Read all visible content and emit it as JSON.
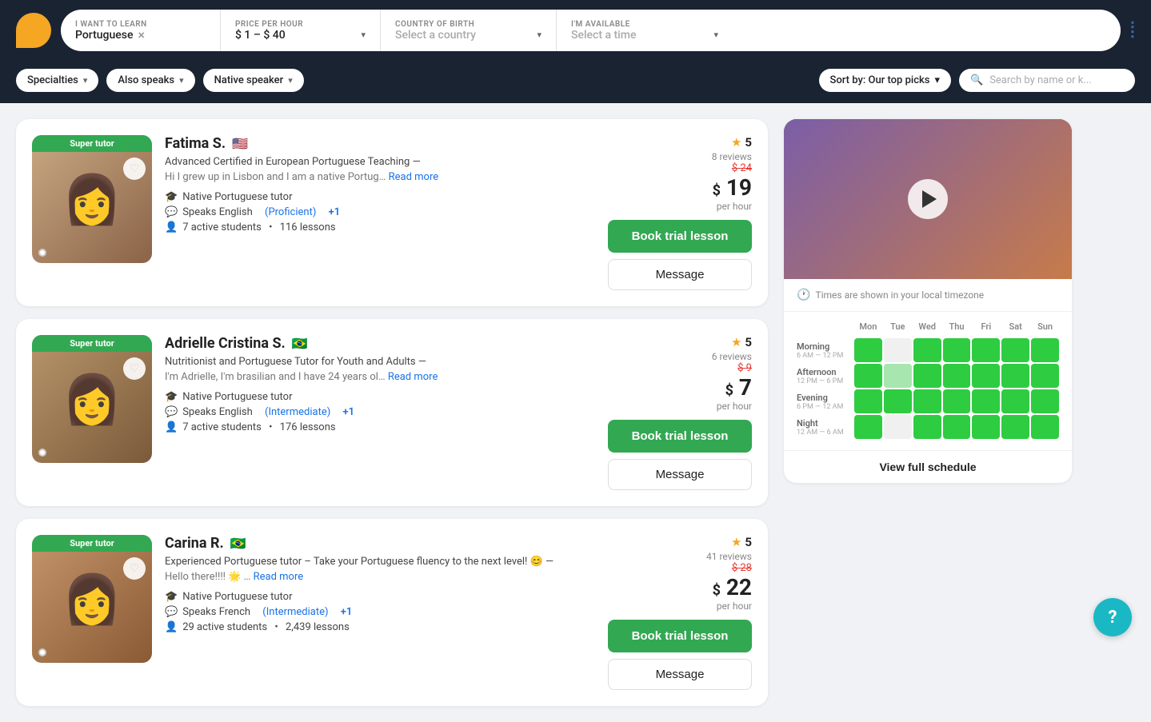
{
  "logo": {
    "alt": "Preply logo"
  },
  "topbar": {
    "learn_label": "I WANT TO LEARN",
    "learn_value": "Portuguese",
    "price_label": "PRICE PER HOUR",
    "price_value": "$ 1 – $ 40",
    "country_label": "COUNTRY OF BIRTH",
    "country_placeholder": "Select a country",
    "available_label": "I'M AVAILABLE",
    "available_placeholder": "Select a time"
  },
  "subbar": {
    "specialties_label": "Specialties",
    "also_speaks_label": "Also speaks",
    "native_speaker_label": "Native speaker",
    "sort_label": "Sort by: Our top picks",
    "search_placeholder": "Search by name or k..."
  },
  "tutors": [
    {
      "name": "Fatima S.",
      "flag": "🇺🇸",
      "badge": "Super tutor",
      "headline": "Advanced Certified in European Portuguese Teaching —",
      "bio": "Hi I grew up in Lisbon and I am a native Portug…",
      "native_tag": "Native Portuguese tutor",
      "speaks": "Speaks English",
      "speaks_level": "(Proficient)",
      "speaks_plus": "+1",
      "students": "7 active students",
      "lessons": "116 lessons",
      "rating": "5",
      "reviews": "8 reviews",
      "price_old": "$ 24",
      "price_new": "19",
      "price_per": "per hour",
      "btn_trial": "Book trial lesson",
      "btn_message": "Message",
      "photo_class": "fatima-bg"
    },
    {
      "name": "Adrielle Cristina S.",
      "flag": "🇧🇷",
      "badge": "Super tutor",
      "headline": "Nutritionist and Portuguese Tutor for Youth and Adults —",
      "bio": "I'm Adrielle, I'm brasilian and I have 24 years ol…",
      "native_tag": "Native Portuguese tutor",
      "speaks": "Speaks English",
      "speaks_level": "(Intermediate)",
      "speaks_plus": "+1",
      "students": "7 active students",
      "lessons": "176 lessons",
      "rating": "5",
      "reviews": "6 reviews",
      "price_old": "$ 9",
      "price_new": "7",
      "price_per": "per hour",
      "btn_trial": "Book trial lesson",
      "btn_message": "Message",
      "photo_class": "adrielle-bg"
    },
    {
      "name": "Carina R.",
      "flag": "🇧🇷",
      "badge": "Super tutor",
      "headline": "Experienced Portuguese tutor – Take your Portuguese fluency to the next level! 😊 —",
      "bio": "Hello there!!!! 🌟 …",
      "native_tag": "Native Portuguese tutor",
      "speaks": "Speaks French",
      "speaks_level": "(Intermediate)",
      "speaks_plus": "+1",
      "students": "29 active students",
      "lessons": "2,439 lessons",
      "rating": "5",
      "reviews": "41 reviews",
      "price_old": "$ 28",
      "price_new": "22",
      "price_per": "per hour",
      "btn_trial": "Book trial lesson",
      "btn_message": "Message",
      "photo_class": "carina-bg"
    }
  ],
  "sidebar": {
    "timezone_note": "Times are shown in your local timezone",
    "days": [
      "Mon",
      "Tue",
      "Wed",
      "Thu",
      "Fri",
      "Sat",
      "Sun"
    ],
    "schedule_rows": [
      {
        "name": "Morning",
        "range": "6 AM — 12 PM",
        "cells": [
          "green",
          "empty",
          "green",
          "green",
          "green",
          "green",
          "green"
        ]
      },
      {
        "name": "Afternoon",
        "range": "12 PM — 6 PM",
        "cells": [
          "green",
          "light-green",
          "green",
          "green",
          "green",
          "green",
          "green"
        ]
      },
      {
        "name": "Evening",
        "range": "6 PM — 12 AM",
        "cells": [
          "green",
          "green",
          "green",
          "green",
          "green",
          "green",
          "green"
        ]
      },
      {
        "name": "Night",
        "range": "12 AM — 6 AM",
        "cells": [
          "green",
          "empty",
          "green",
          "green",
          "green",
          "green",
          "green"
        ]
      }
    ],
    "view_schedule_btn": "View full schedule"
  },
  "help_btn": "?"
}
